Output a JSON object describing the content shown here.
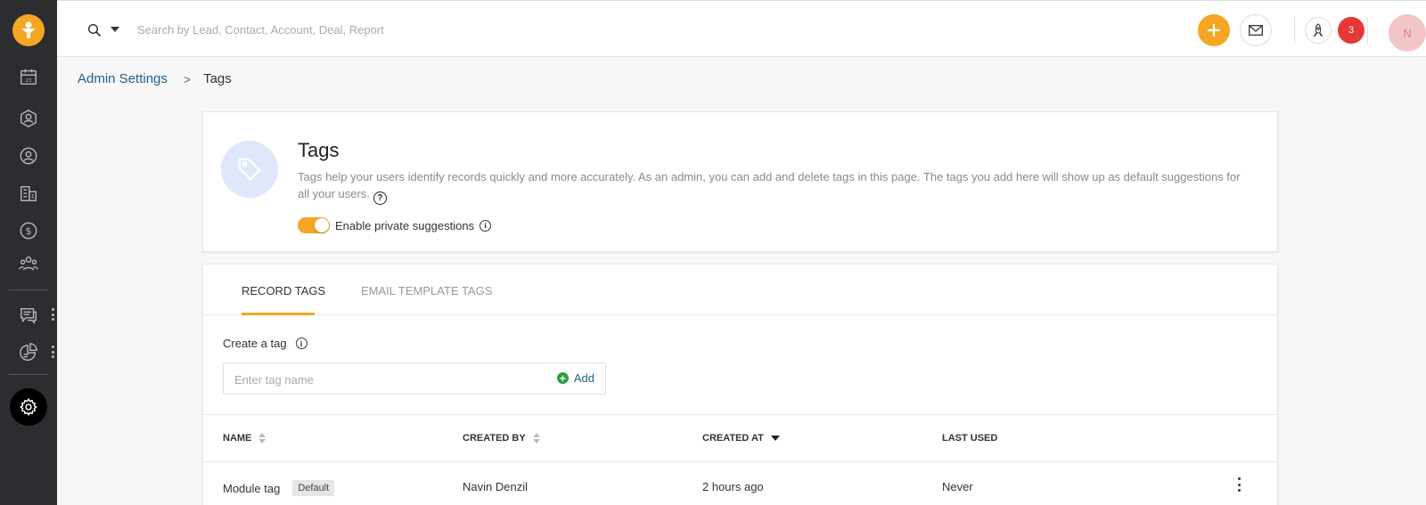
{
  "search": {
    "placeholder": "Search by Lead, Contact, Account, Deal, Report"
  },
  "notifications": {
    "count": "3"
  },
  "user": {
    "initial": "N"
  },
  "breadcrumb": {
    "parent": "Admin Settings",
    "separator": ">",
    "current": "Tags"
  },
  "header": {
    "title": "Tags",
    "description": "Tags help your users identify records quickly and more accurately. As an admin, you can add and delete tags in this page. The tags you add here will show up as default suggestions for all your users.",
    "toggle_label": "Enable private suggestions",
    "toggle_on": true
  },
  "tabs": [
    {
      "label": "RECORD TAGS",
      "active": true
    },
    {
      "label": "EMAIL TEMPLATE TAGS",
      "active": false
    }
  ],
  "create": {
    "label": "Create a tag",
    "placeholder": "Enter tag name",
    "add_label": "Add"
  },
  "table": {
    "columns": [
      "NAME",
      "CREATED BY",
      "CREATED AT",
      "LAST USED"
    ],
    "rows": [
      {
        "name": "Module tag",
        "badge": "Default",
        "created_by": "Navin Denzil",
        "created_at": "2 hours ago",
        "last_used": "Never"
      }
    ]
  },
  "colors": {
    "accent": "#f5a623",
    "sidebar": "#2b2d30",
    "link": "#1f5f8b",
    "notification": "#e53935",
    "add_green": "#2e9e3e"
  },
  "icons": {
    "sidebar": [
      "logo-icon",
      "calendar-icon",
      "lead-icon",
      "contact-icon",
      "account-icon",
      "deal-icon",
      "team-icon",
      "chat-icon",
      "reports-icon",
      "settings-icon"
    ],
    "topbar": [
      "search-icon",
      "add-icon",
      "mail-icon",
      "rocket-icon"
    ]
  }
}
